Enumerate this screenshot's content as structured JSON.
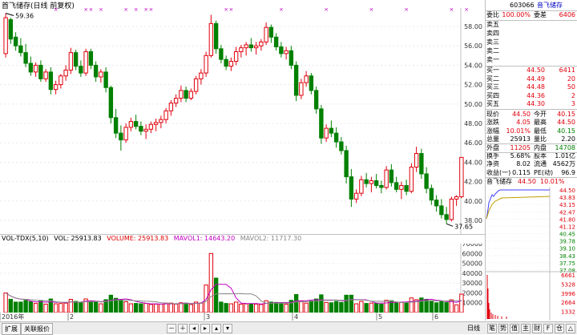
{
  "chart_title": "首飞储存(日线 前复权)",
  "marks_count": 0,
  "candles": {
    "ylim": [
      36.6,
      59.9
    ],
    "ticks": [
      38.0,
      40.0,
      42.0,
      44.0,
      46.0,
      48.0,
      50.0,
      52.0,
      54.0,
      56.0,
      58.0
    ],
    "high_label": "59.36",
    "low_label": "37.65",
    "ohlc": [
      [
        55.2,
        59.36,
        54.8,
        58.9
      ],
      [
        58.7,
        58.9,
        56.2,
        56.7
      ],
      [
        56.9,
        57.4,
        55.5,
        56.0
      ],
      [
        56.0,
        56.8,
        54.9,
        55.3
      ],
      [
        55.3,
        56.2,
        53.8,
        54.2
      ],
      [
        54.2,
        54.9,
        52.9,
        53.3
      ],
      [
        53.3,
        54.3,
        52.8,
        54.0
      ],
      [
        54.0,
        54.5,
        52.3,
        52.6
      ],
      [
        52.6,
        53.6,
        52.3,
        53.3
      ],
      [
        53.3,
        53.8,
        51.0,
        51.5
      ],
      [
        51.5,
        52.4,
        51.0,
        52.0
      ],
      [
        52.0,
        53.1,
        51.6,
        52.9
      ],
      [
        52.9,
        54.0,
        52.4,
        53.5
      ],
      [
        53.5,
        55.8,
        53.1,
        55.3
      ],
      [
        55.3,
        55.6,
        53.5,
        53.9
      ],
      [
        53.9,
        54.5,
        52.8,
        53.2
      ],
      [
        53.2,
        55.7,
        52.9,
        55.4
      ],
      [
        55.4,
        55.7,
        53.6,
        54.0
      ],
      [
        54.0,
        54.4,
        52.3,
        52.8
      ],
      [
        52.8,
        53.6,
        52.2,
        53.3
      ],
      [
        53.3,
        53.8,
        51.2,
        51.7
      ],
      [
        51.7,
        51.9,
        48.0,
        48.6
      ],
      [
        48.6,
        49.5,
        46.5,
        47.0
      ],
      [
        47.0,
        47.8,
        45.2,
        46.3
      ],
      [
        46.3,
        48.0,
        46.0,
        47.6
      ],
      [
        47.6,
        48.6,
        47.2,
        48.2
      ],
      [
        48.2,
        48.9,
        47.4,
        47.7
      ],
      [
        47.7,
        48.2,
        46.8,
        47.2
      ],
      [
        47.2,
        47.9,
        46.4,
        47.4
      ],
      [
        47.4,
        48.2,
        47.0,
        47.9
      ],
      [
        47.9,
        48.5,
        47.2,
        48.1
      ],
      [
        48.1,
        48.8,
        47.5,
        48.4
      ],
      [
        48.4,
        49.6,
        48.0,
        49.3
      ],
      [
        49.3,
        50.4,
        48.8,
        50.1
      ],
      [
        50.1,
        51.0,
        49.7,
        50.6
      ],
      [
        50.6,
        51.9,
        50.2,
        51.4
      ],
      [
        51.4,
        51.8,
        50.2,
        50.6
      ],
      [
        50.6,
        51.6,
        50.4,
        51.3
      ],
      [
        51.3,
        52.9,
        51.0,
        52.6
      ],
      [
        52.6,
        53.6,
        52.0,
        53.2
      ],
      [
        53.2,
        55.4,
        52.8,
        55.0
      ],
      [
        55.0,
        59.2,
        54.8,
        58.3
      ],
      [
        58.3,
        58.6,
        55.2,
        55.7
      ],
      [
        55.7,
        56.1,
        54.2,
        54.6
      ],
      [
        54.6,
        55.0,
        53.5,
        53.9
      ],
      [
        53.9,
        54.8,
        53.4,
        54.4
      ],
      [
        54.4,
        55.9,
        54.0,
        55.4
      ],
      [
        55.4,
        56.1,
        54.8,
        55.8
      ],
      [
        55.8,
        56.4,
        55.0,
        56.1
      ],
      [
        56.1,
        56.8,
        55.4,
        55.8
      ],
      [
        55.8,
        56.4,
        55.1,
        56.0
      ],
      [
        56.0,
        56.7,
        55.5,
        56.4
      ],
      [
        56.4,
        58.4,
        56.1,
        57.9
      ],
      [
        57.9,
        58.2,
        56.3,
        56.9
      ],
      [
        56.9,
        57.3,
        55.5,
        55.9
      ],
      [
        55.9,
        56.4,
        54.8,
        55.2
      ],
      [
        55.2,
        55.9,
        54.6,
        55.5
      ],
      [
        55.5,
        56.0,
        53.6,
        54.0
      ],
      [
        54.0,
        54.4,
        50.3,
        50.9
      ],
      [
        50.9,
        52.6,
        50.5,
        52.2
      ],
      [
        52.2,
        53.4,
        51.8,
        52.9
      ],
      [
        52.9,
        53.2,
        51.0,
        51.4
      ],
      [
        51.4,
        51.8,
        49.0,
        49.5
      ],
      [
        49.5,
        49.9,
        45.9,
        46.5
      ],
      [
        46.5,
        47.9,
        46.1,
        47.5
      ],
      [
        47.5,
        48.3,
        46.6,
        47.0
      ],
      [
        47.0,
        47.6,
        45.5,
        46.1
      ],
      [
        46.1,
        46.6,
        44.8,
        45.2
      ],
      [
        45.2,
        45.7,
        41.8,
        42.5
      ],
      [
        42.5,
        43.3,
        39.4,
        40.2
      ],
      [
        40.2,
        41.2,
        39.8,
        40.8
      ],
      [
        40.8,
        42.6,
        40.5,
        42.2
      ],
      [
        42.2,
        42.9,
        41.4,
        41.8
      ],
      [
        41.8,
        42.5,
        40.9,
        42.1
      ],
      [
        42.1,
        42.8,
        41.3,
        41.6
      ],
      [
        41.6,
        42.1,
        40.8,
        41.4
      ],
      [
        41.4,
        43.6,
        41.2,
        43.2
      ],
      [
        43.2,
        43.8,
        41.5,
        41.9
      ],
      [
        41.9,
        42.5,
        40.9,
        41.2
      ],
      [
        41.2,
        42.0,
        40.2,
        41.6
      ],
      [
        41.6,
        42.2,
        40.6,
        41.0
      ],
      [
        41.0,
        43.9,
        40.8,
        43.5
      ],
      [
        43.5,
        45.6,
        43.0,
        44.9
      ],
      [
        44.9,
        45.4,
        42.3,
        42.8
      ],
      [
        42.8,
        43.5,
        40.8,
        41.3
      ],
      [
        41.3,
        41.7,
        39.6,
        40.1
      ],
      [
        40.1,
        40.6,
        38.9,
        39.5
      ],
      [
        39.5,
        40.2,
        38.2,
        38.6
      ],
      [
        38.6,
        39.4,
        37.65,
        38.1
      ],
      [
        38.1,
        40.45,
        37.9,
        40.2
      ],
      [
        40.2,
        40.6,
        39.5,
        40.45
      ],
      [
        40.45,
        44.5,
        40.3,
        44.5
      ]
    ]
  },
  "volume": {
    "header": "VOL-TDX(5,10)",
    "vol_label": "VOL: 25913.83",
    "volume_label": "VOLUME: 25913.83",
    "ma5_label": "MAVOL1: 14643.20",
    "ma10_label": "MAVOL2: 11717.30",
    "ticks": [
      "70000",
      "60000",
      "50000",
      "40000",
      "30000",
      "20000",
      "10000"
    ]
  },
  "months": [
    "2016年",
    "2",
    "3",
    "4",
    "5",
    "6"
  ],
  "quote": {
    "code": "603066",
    "name": "音飞储存",
    "weibi_label": "委比",
    "weibi": "100.00%",
    "weicha_label": "委差",
    "weicha": "6406",
    "sells": [
      [
        "卖五",
        ""
      ],
      [
        "卖四",
        ""
      ],
      [
        "卖三",
        ""
      ],
      [
        "卖二",
        ""
      ],
      [
        "卖一",
        ""
      ]
    ],
    "buys": [
      [
        "买一",
        "44.50",
        "6411"
      ],
      [
        "买二",
        "44.49",
        "20"
      ],
      [
        "买三",
        "44.48",
        "50"
      ],
      [
        "买四",
        "44.36",
        "2"
      ],
      [
        "买五",
        "44.30",
        "3"
      ]
    ],
    "stats": [
      [
        "现价",
        "44.50",
        "今开",
        "40.15"
      ],
      [
        "涨跌",
        "4.05",
        "最高",
        "44.50"
      ],
      [
        "涨幅",
        "10.01%",
        "最低",
        "40.15"
      ],
      [
        "总量",
        "25913",
        "量比",
        "2.20"
      ],
      [
        "外盘",
        "11205",
        "内盘",
        "14708"
      ],
      [
        "换手",
        "5.68%",
        "股本",
        "1.01亿"
      ],
      [
        "净资",
        "8.02",
        "流通",
        "4562万"
      ],
      [
        "收益(一)",
        "0.115",
        "PE(动)",
        "96.9"
      ]
    ]
  },
  "intraday": {
    "name": "音飞储存",
    "price": "44.50",
    "pct": "10.01%",
    "price_ticks": [
      "44.50",
      "43.83",
      "43.15",
      "42.47",
      "41.80",
      "41.12",
      "40.45",
      "39.78",
      "39.10",
      "38.43",
      "37.75",
      "37.08"
    ],
    "vol_ticks": [
      "6661",
      "5328",
      "3996",
      "2664",
      "1332"
    ]
  },
  "statusbar": {
    "left_tabs": [
      "扩展",
      "关联报价"
    ],
    "mid_icons": [
      "zoom-out",
      "zoom-in",
      "left",
      "right",
      "up",
      "down"
    ],
    "right_label": "日线"
  }
}
